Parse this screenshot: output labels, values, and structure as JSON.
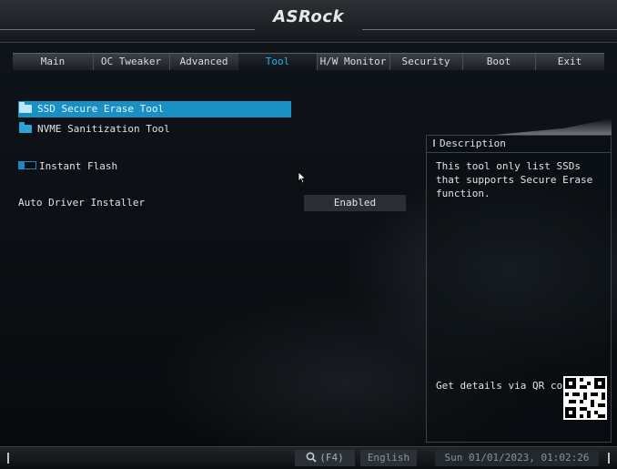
{
  "brand": "ASRock",
  "tabs": [
    {
      "label": "Main"
    },
    {
      "label": "OC Tweaker"
    },
    {
      "label": "Advanced"
    },
    {
      "label": "Tool"
    },
    {
      "label": "H/W Monitor"
    },
    {
      "label": "Security"
    },
    {
      "label": "Boot"
    },
    {
      "label": "Exit"
    }
  ],
  "active_tab": "Tool",
  "menu": {
    "ssd_secure_erase": "SSD Secure Erase Tool",
    "nvme_sanitization": "NVME Sanitization Tool",
    "instant_flash": "Instant Flash",
    "auto_driver_installer": {
      "label": "Auto Driver Installer",
      "value": "Enabled"
    }
  },
  "description": {
    "header": "Description",
    "text": "This tool only list SSDs that supports Secure Erase function.",
    "qr_label": "Get details via QR code"
  },
  "footer": {
    "search": "(F4)",
    "language": "English",
    "datetime": "Sun 01/01/2023, 01:02:26"
  },
  "colors": {
    "accent": "#1cb4f0",
    "selection": "#1a8fc4"
  },
  "icons": [
    "folder-icon",
    "instant-flash-icon",
    "mouse-cursor-icon",
    "search-icon",
    "qr-code-icon"
  ]
}
